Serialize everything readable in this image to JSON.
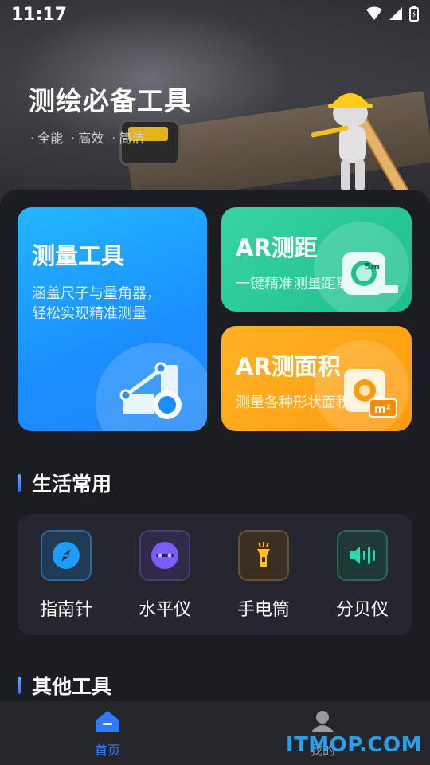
{
  "status_bar": {
    "time": "11:17"
  },
  "hero": {
    "title": "测绘必备工具",
    "tags": [
      "全能",
      "高效",
      "简洁"
    ]
  },
  "cards": {
    "measure": {
      "title": "测量工具",
      "desc_line1": "涵盖尺子与量角器，",
      "desc_line2": "轻松实现精准测量"
    },
    "ar_distance": {
      "title": "AR测距",
      "desc": "一键精准测量距离",
      "icon_text": "5m"
    },
    "ar_area": {
      "title": "AR测面积",
      "desc": "测量各种形状面积",
      "icon_text": "m²"
    }
  },
  "sections": {
    "daily": "生活常用",
    "other": "其他工具"
  },
  "tools": [
    {
      "label": "指南针",
      "icon": "compass-icon"
    },
    {
      "label": "水平仪",
      "icon": "level-icon"
    },
    {
      "label": "手电筒",
      "icon": "flashlight-icon"
    },
    {
      "label": "分贝仪",
      "icon": "decibel-icon"
    }
  ],
  "bottom_nav": {
    "home": {
      "label": "首页",
      "icon": "home-icon"
    },
    "mine": {
      "label": "我的",
      "icon": "user-icon"
    }
  },
  "watermark": "ITMOP.COM",
  "colors": {
    "accent": "#2f7bff",
    "card_blue": "#1a8eff",
    "card_green": "#1fbf8f",
    "card_orange": "#ff9a0c",
    "background": "#1c1c23"
  }
}
